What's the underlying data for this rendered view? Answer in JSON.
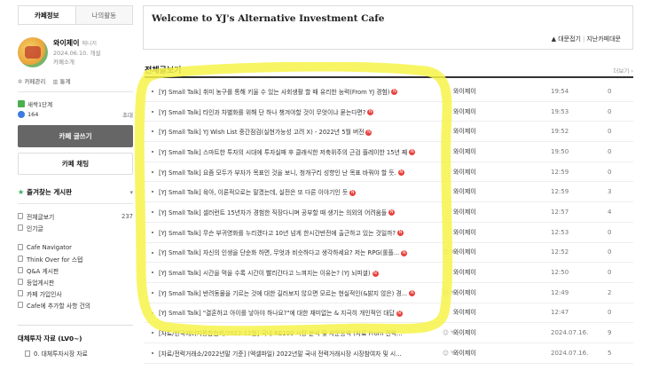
{
  "sidebar": {
    "tabs": [
      "카페정보",
      "나의활동"
    ],
    "profile": {
      "nickname": "와이제이",
      "role": "매니저",
      "since": "2024.06.10. 개설",
      "intro": "카페소개"
    },
    "admin_links": [
      "카페관리",
      "통계"
    ],
    "level": "새싹1단계",
    "member_count": "164",
    "invite": "초대",
    "write_button": "카페 글쓰기",
    "chat_button": "카페 채팅",
    "favorites_title": "즐겨찾는 게시판",
    "menu_group1": [
      {
        "label": "전체글보기",
        "count": "237"
      },
      {
        "label": "인기글",
        "count": ""
      }
    ],
    "menu_group2": [
      {
        "label": "Cafe Navigator"
      },
      {
        "label": "Think Over for 스텝"
      },
      {
        "label": "Q&A 게시판"
      },
      {
        "label": "등업게시판"
      },
      {
        "label": "카페 가입인사"
      },
      {
        "label": "Cafe에 추가할 사항 건의"
      }
    ],
    "sub_section_title": "대체투자 자료 (LV0~)",
    "sub_section_item": "0. 대체투자시장 자료"
  },
  "welcome": {
    "title": "Welcome to YJ's Alternative Investment Cafe",
    "link1": "▲ 대문접기",
    "link2": "지난카페대문"
  },
  "board": {
    "title": "전체글보기",
    "more": "더보기 ›",
    "rows": [
      {
        "title": "[YJ Small Talk] 취미 농구를 통해 키울 수 있는 사회생활 할 때 유리한 능력(From YJ 경험)",
        "new": true,
        "extra": "",
        "author": "와이제이",
        "date": "19:54",
        "views": "0"
      },
      {
        "title": "[YJ Small Talk] 타인과 차별화를 위해 단 하나 챙겨야할 것이 무엇이냐 묻는다면?",
        "new": true,
        "extra": "",
        "author": "와이제이",
        "date": "19:53",
        "views": "0"
      },
      {
        "title": "[YJ Small Talk] YJ Wish List 중간점검(실현가능성 고려 X) - 2022년 5월 버전",
        "new": true,
        "extra": "",
        "author": "와이제이",
        "date": "19:52",
        "views": "0"
      },
      {
        "title": "[YJ Small Talk] 스마트한 투자의 시대에 투자실패 후 클래식한 저축위주의 근검 플레이한 15년 째",
        "new": true,
        "extra": "",
        "author": "와이제이",
        "date": "19:50",
        "views": "0"
      },
      {
        "title": "[YJ Small Talk] 요즘 모두가 부자가 목표인 것을 보니, 청개구리 성향인 난 목표 바꿔야 할 듯.",
        "new": true,
        "extra": "",
        "author": "와이제이",
        "date": "12:59",
        "views": "0"
      },
      {
        "title": "[YJ Small Talk] 육아, 이론적으로는 말겠는데, 실전은 또 다른 이야기인 듯",
        "new": true,
        "extra": "",
        "author": "와이제이",
        "date": "12:59",
        "views": "3"
      },
      {
        "title": "[YJ Small Talk] 셀러런트 15년차가 경험한 직장다니며 공부할 때 생기는 의외의 어려움들",
        "new": true,
        "extra": "",
        "author": "와이제이",
        "date": "12:57",
        "views": "4"
      },
      {
        "title": "[YJ Small Talk] 무슨 부귀영화를 누리겠다고 10년 넘게 한시간반전에 출근하고 있는 것일까?",
        "new": true,
        "extra": "",
        "author": "와이제이",
        "date": "12:53",
        "views": "0"
      },
      {
        "title": "[YJ Small Talk] 자신의 인생을 단순화 하면, 무엇과 비슷하다고 생각하세요? 저는 RPG(롤플...",
        "new": true,
        "extra": "☺ ✎",
        "author": "와이제이",
        "date": "12:52",
        "views": "0"
      },
      {
        "title": "[YJ Small Talk] 시간을 먹을 수록 시간이 빨리간다고 느껴지는 이유는? (YJ 뇌피셜)",
        "new": true,
        "extra": "",
        "author": "와이제이",
        "date": "12:50",
        "views": "0"
      },
      {
        "title": "[YJ Small Talk] 반려동물을 기르는 것에 대한 길러보지 않으면 모르는 현실적인(&밝지 않은) 경...",
        "new": true,
        "extra": "☺ ✎",
        "author": "와이제이",
        "date": "12:49",
        "views": "2"
      },
      {
        "title": "[YJ Small Talk] \"결혼하고 아이를 낳아야 하나요?\"에 대한 재미없는 & 지극히 개인적인 대답",
        "new": true,
        "extra": "",
        "author": "와이제이",
        "date": "12:47",
        "views": "0"
      },
      {
        "title": "[자료/한국에너지통합협회/2022-12월] 국내 RE100 시장 분석 및 자문용역 (자료 From 전력...",
        "new": false,
        "extra": "☺ ✎",
        "author": "와이제이",
        "date": "2024.07.16.",
        "views": "9"
      },
      {
        "title": "[자료/전력거래소/2022년말 기준] (엑셀파일) 2022년말 국내 전력거래시장 시장참여자 및 시...",
        "new": false,
        "extra": "☺ ✎",
        "author": "와이제이",
        "date": "2024.07.16.",
        "views": "5"
      }
    ]
  },
  "colors": {
    "highlight": "#f7f34a",
    "new_badge": "#e8413c",
    "write_button_bg": "#666666",
    "fav_star": "#2eb35e"
  }
}
